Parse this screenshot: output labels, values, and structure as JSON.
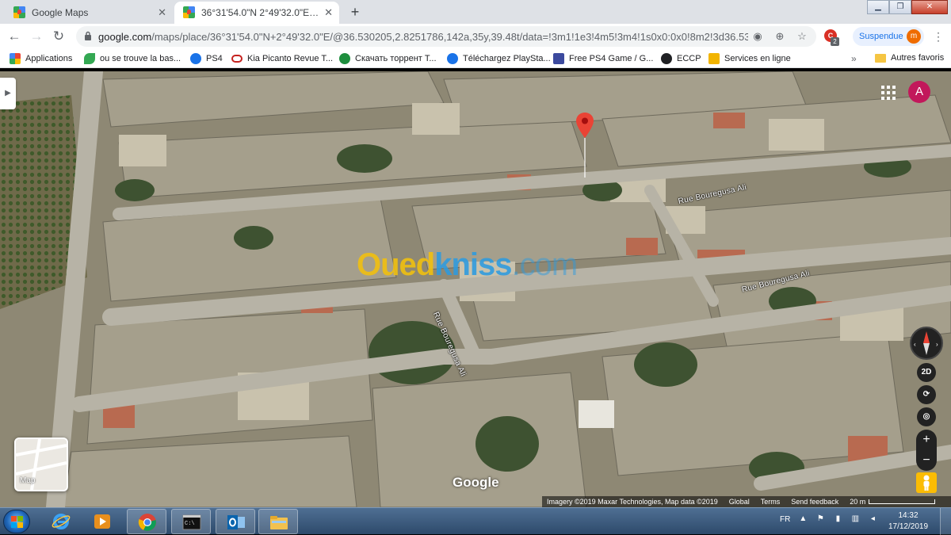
{
  "browser": {
    "tabs": [
      {
        "title": "Google Maps",
        "active": false
      },
      {
        "title": "36°31'54.0\"N 2°49'32.0\"E - Goog",
        "active": true
      }
    ],
    "new_tab_symbol": "+",
    "back_symbol": "←",
    "forward_symbol": "→",
    "reload_symbol": "↻",
    "url_domain": "google.com",
    "url_path": "/maps/place/36°31'54.0\"N+2°49'32.0\"E/@36.530205,2.8251786,142a,35y,39.48t/data=!3m1!1e3!4m5!3m4!1s0x0:0x0!8m2!3d36.5316667!...",
    "extension_badge": "2",
    "profile_status": "Suspendue",
    "profile_initial": "m"
  },
  "bookmarks": {
    "items": [
      {
        "label": "Applications",
        "icon": "apps-grid-icon",
        "color": "#4285f4"
      },
      {
        "label": "ou se trouve la bas...",
        "icon": "leaf-icon",
        "color": "#34a853"
      },
      {
        "label": "PS4",
        "icon": "amazon-icon",
        "color": "#1a73e8"
      },
      {
        "label": "Kia Picanto Revue T...",
        "icon": "kia-icon",
        "color": "#c5221f"
      },
      {
        "label": "Скачать торрент Т...",
        "icon": "torrent-icon",
        "color": "#1e8e3e"
      },
      {
        "label": "Téléchargez PlaySta...",
        "icon": "torrent-icon",
        "color": "#1a73e8"
      },
      {
        "label": "Free PS4 Game / G...",
        "icon": "playstation-icon",
        "color": "#3c4a9e"
      },
      {
        "label": "ECCP",
        "icon": "globe-icon",
        "color": "#202124"
      },
      {
        "label": "Services en ligne",
        "icon": "bank-icon",
        "color": "#f2b400"
      }
    ],
    "overflow_symbol": "»",
    "folder_label": "Autres favoris"
  },
  "map": {
    "account_initial": "A",
    "streets": [
      "Rue Bouregusa Ali",
      "Rue Bouregusa Ali",
      "Rue Bouregusa Ali"
    ],
    "watermark": {
      "part1": "Oued",
      "part2": "kniss",
      "part3": ".com"
    },
    "view_mode": "2D",
    "zoom_in": "+",
    "zoom_out": "−",
    "minimap_label": "Map",
    "logo": "Google",
    "attribution": {
      "imagery": "Imagery ©2019 Maxar Technologies, Map data ©2019",
      "global": "Global",
      "terms": "Terms",
      "feedback": "Send feedback",
      "scale": "20 m"
    },
    "side_panel_toggle": "▶"
  },
  "taskbar": {
    "apps": [
      "internet-explorer",
      "media-player",
      "chrome",
      "cmd",
      "outlook",
      "file-explorer"
    ],
    "language": "FR",
    "time": "14:32",
    "date": "17/12/2019"
  },
  "colors": {
    "tab_strip": "#dee1e6",
    "accent_blue": "#1a73e8",
    "pin_red": "#ea4335",
    "watermark_yellow": "#f3c10d",
    "watermark_blue": "#2d9be0"
  }
}
